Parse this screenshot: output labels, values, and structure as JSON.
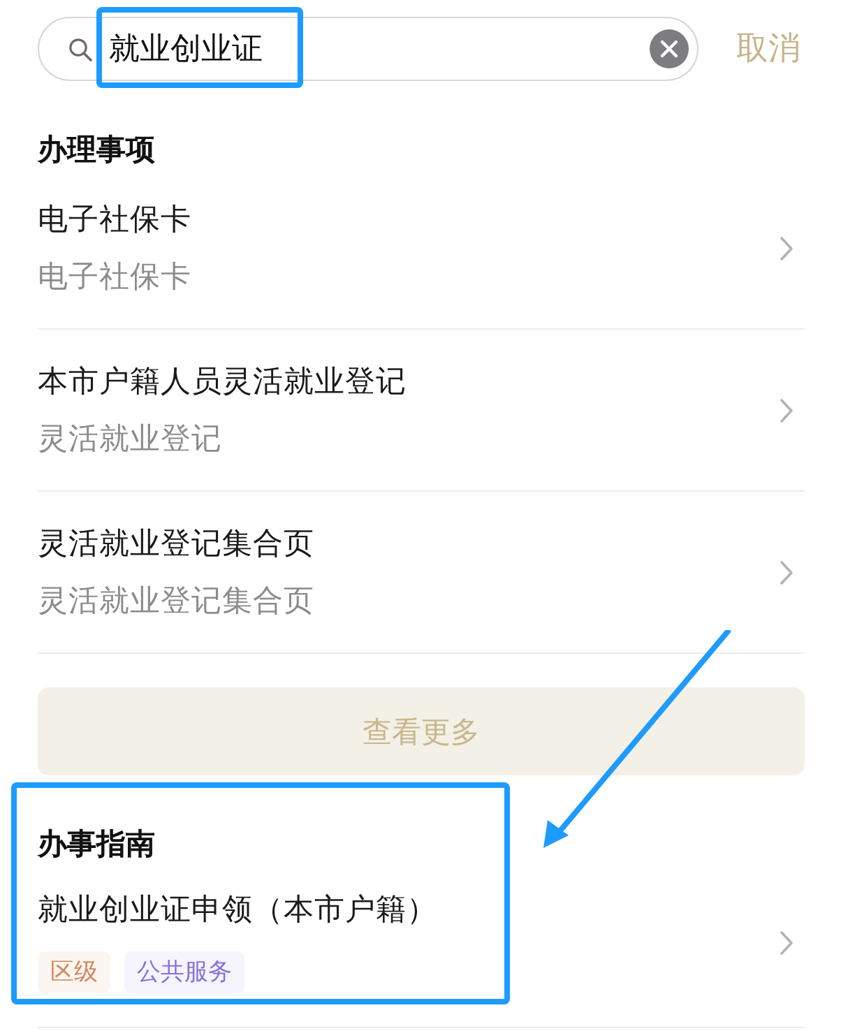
{
  "search": {
    "value": "就业创业证",
    "cancel": "取消"
  },
  "services": {
    "title": "办理事项",
    "items": [
      {
        "title": "电子社保卡",
        "subtitle": "电子社保卡"
      },
      {
        "title": "本市户籍人员灵活就业登记",
        "subtitle": "灵活就业登记"
      },
      {
        "title": "灵活就业登记集合页",
        "subtitle": "灵活就业登记集合页"
      }
    ],
    "more_button": "查看更多"
  },
  "guides": {
    "title": "办事指南",
    "items": [
      {
        "title": "就业创业证申领（本市户籍）",
        "tags": [
          {
            "label": "区级",
            "color": "#d4875a"
          },
          {
            "label": "公共服务",
            "color": "#8673d9"
          }
        ]
      }
    ]
  }
}
